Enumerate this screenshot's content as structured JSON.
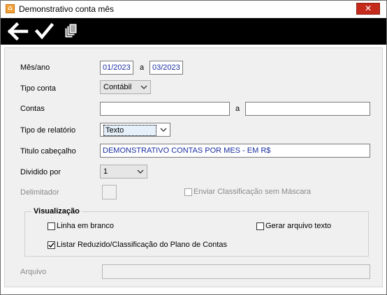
{
  "window": {
    "title": "Demonstrativo conta mês",
    "close_label": "✕"
  },
  "toolbar": {
    "back_icon": "arrow-left-icon",
    "confirm_icon": "checkmark-icon",
    "copy_icon": "copy-pages-icon"
  },
  "form": {
    "periodo": {
      "label": "Mês/ano",
      "from": "01/2023",
      "sep": "a",
      "to": "03/2023"
    },
    "tipo_conta": {
      "label": "Tipo conta",
      "value": "Contábil"
    },
    "contas": {
      "label": "Contas",
      "from": "",
      "sep": "a",
      "to": ""
    },
    "tipo_relatorio": {
      "label": "Tipo de relatório",
      "value": "Texto"
    },
    "titulo": {
      "label": "Titulo cabeçalho",
      "value": "DEMONSTRATIVO CONTAS POR MES  - EM R$"
    },
    "dividido": {
      "label": "Dividido por",
      "value": "1"
    },
    "delimitador": {
      "label": "Delimitador",
      "value": ""
    },
    "enviar_class": {
      "label": "Enviar Classificação sem Máscara",
      "checked": false,
      "enabled": false
    },
    "visualizacao": {
      "title": "Visualização",
      "linha_branco": {
        "label": "Linha em branco",
        "checked": false
      },
      "gerar_arquivo": {
        "label": "Gerar arquivo texto",
        "checked": false
      },
      "listar_reduzido": {
        "label": "Listar Reduzido/Classificação do Plano de Contas",
        "checked": true
      }
    },
    "arquivo": {
      "label": "Arquivo",
      "value": ""
    }
  },
  "colors": {
    "toolbar_bg": "#000000",
    "input_text": "#1a2ea0",
    "panel_bg": "#f0f0f0",
    "close_bg": "#c42b1c"
  }
}
